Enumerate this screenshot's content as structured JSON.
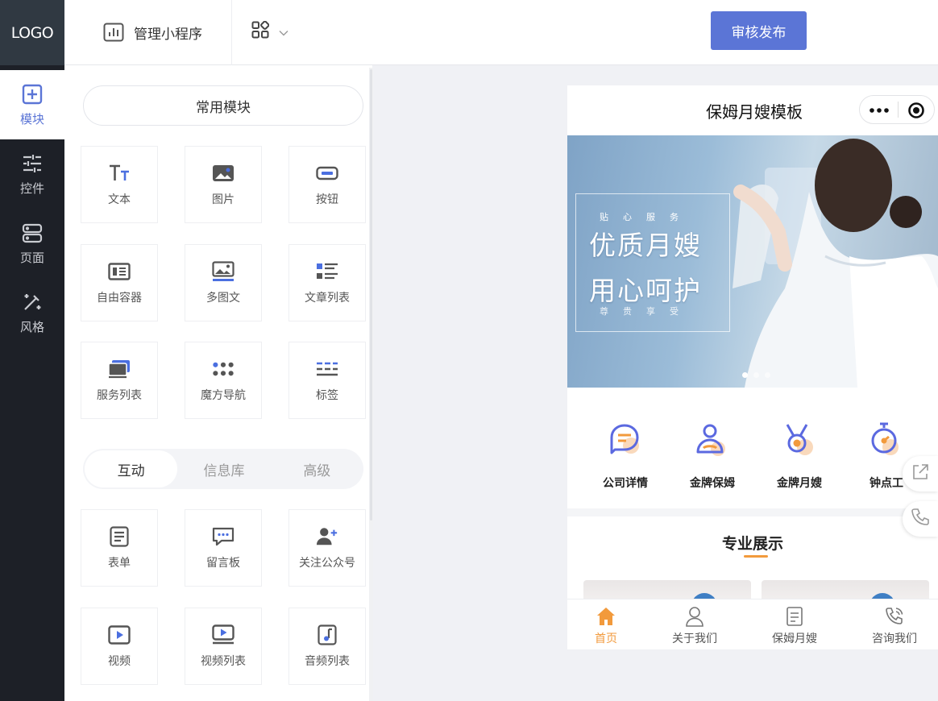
{
  "brand": {
    "logo": "LOGO"
  },
  "sidebar": {
    "items": [
      {
        "label": "模块",
        "icon": "plus-square-icon",
        "active": true
      },
      {
        "label": "控件",
        "icon": "sliders-icon"
      },
      {
        "label": "页面",
        "icon": "pages-icon"
      },
      {
        "label": "风格",
        "icon": "magic-wand-icon"
      }
    ]
  },
  "header": {
    "manage_label": "管理小程序",
    "manage_icon": "bar-chart-icon",
    "apps_icon": "grid-icon",
    "publish_label": "审核发布"
  },
  "panel": {
    "common_title": "常用模块",
    "common_items": [
      {
        "label": "文本",
        "icon": "text-icon"
      },
      {
        "label": "图片",
        "icon": "image-icon"
      },
      {
        "label": "按钮",
        "icon": "button-icon"
      },
      {
        "label": "自由容器",
        "icon": "container-icon"
      },
      {
        "label": "多图文",
        "icon": "multi-image-icon"
      },
      {
        "label": "文章列表",
        "icon": "article-list-icon"
      },
      {
        "label": "服务列表",
        "icon": "service-list-icon"
      },
      {
        "label": "魔方导航",
        "icon": "cube-nav-icon"
      },
      {
        "label": "标签",
        "icon": "tag-icon"
      }
    ],
    "tabs": [
      {
        "label": "互动",
        "active": true
      },
      {
        "label": "信息库"
      },
      {
        "label": "高级"
      }
    ],
    "interactive_items": [
      {
        "label": "表单",
        "icon": "form-icon"
      },
      {
        "label": "留言板",
        "icon": "message-board-icon"
      },
      {
        "label": "关注公众号",
        "icon": "follow-account-icon"
      },
      {
        "label": "视频",
        "icon": "video-icon"
      },
      {
        "label": "视频列表",
        "icon": "video-list-icon"
      },
      {
        "label": "音频列表",
        "icon": "audio-list-icon"
      }
    ]
  },
  "preview": {
    "title": "保姆月嫂模板",
    "banner": {
      "line_top": "贴心服务",
      "line1": "优质月嫂",
      "line2": "用心呵护",
      "line_bottom": "尊贵享受"
    },
    "nav": [
      {
        "label": "公司详情",
        "icon": "company-detail-icon"
      },
      {
        "label": "金牌保姆",
        "icon": "gold-nanny-icon"
      },
      {
        "label": "金牌月嫂",
        "icon": "gold-medal-icon"
      },
      {
        "label": "钟点工",
        "icon": "stopwatch-icon"
      }
    ],
    "section_title": "专业展示",
    "tabbar": [
      {
        "label": "首页",
        "icon": "home-icon",
        "active": true
      },
      {
        "label": "关于我们",
        "icon": "user-icon"
      },
      {
        "label": "保姆月嫂",
        "icon": "document-icon"
      },
      {
        "label": "咨询我们",
        "icon": "phone-icon"
      }
    ]
  },
  "colors": {
    "accent": "#5b75d6",
    "orange": "#f29a3c",
    "sidebar": "#1d2027"
  }
}
